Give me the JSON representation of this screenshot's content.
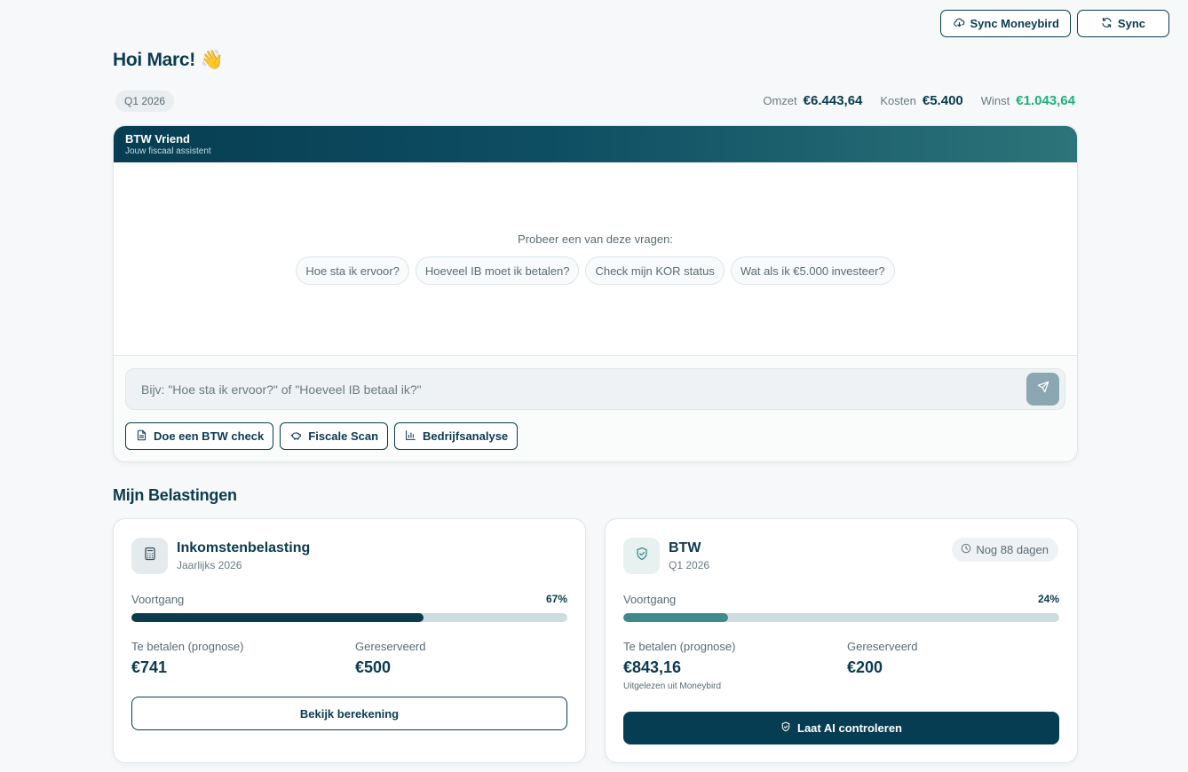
{
  "topbar": {
    "sync_moneybird_label": "Sync Moneybird",
    "sync_label": "Sync"
  },
  "greeting": "Hoi Marc! 👋",
  "period": "Q1 2026",
  "summary": {
    "revenue_label": "Omzet",
    "revenue_value": "€6.443,64",
    "costs_label": "Kosten",
    "costs_value": "€5.400",
    "profit_label": "Winst",
    "profit_value": "€1.043,64",
    "profit_color": "#1fae7a"
  },
  "assistant": {
    "title": "BTW Vriend",
    "subtitle": "Jouw fiscaal assistent",
    "try_label": "Probeer een van deze vragen:",
    "suggestions": [
      "Hoe sta ik ervoor?",
      "Hoeveel IB moet ik betalen?",
      "Check mijn KOR status",
      "Wat als ik €5.000 investeer?"
    ],
    "input_placeholder": "Bijv: \"Hoe sta ik ervoor?\" of \"Hoeveel IB betaal ik?\"",
    "send_icon": "send-icon",
    "quick_actions": [
      {
        "label": "Doe een BTW check",
        "icon": "document-icon"
      },
      {
        "label": "Fiscale Scan",
        "icon": "piggy-bank-icon"
      },
      {
        "label": "Bedrijfsanalyse",
        "icon": "bar-chart-icon"
      }
    ]
  },
  "taxes": {
    "section_title": "Mijn Belastingen",
    "income_tax": {
      "title": "Inkomstenbelasting",
      "subtitle": "Jaarlijks 2026",
      "icon": "calculator-icon",
      "progress_label": "Voortgang",
      "progress_text": "67%",
      "progress_percent": 67,
      "due_label": "Te betalen (prognose)",
      "due_value": "€741",
      "reserved_label": "Gereserveerd",
      "reserved_value": "€500",
      "button_label": "Bekijk berekening"
    },
    "vat": {
      "title": "BTW",
      "subtitle": "Q1 2026",
      "icon": "shield-check-icon",
      "deadline_label": "Nog 88 dagen",
      "deadline_icon": "clock-icon",
      "progress_label": "Voortgang",
      "progress_text": "24%",
      "progress_percent": 24,
      "due_label": "Te betalen (prognose)",
      "due_value": "€843,16",
      "due_note": "Uitgelezen uit Moneybird",
      "reserved_label": "Gereserveerd",
      "reserved_value": "€200",
      "button_label": "Laat AI controleren"
    }
  }
}
